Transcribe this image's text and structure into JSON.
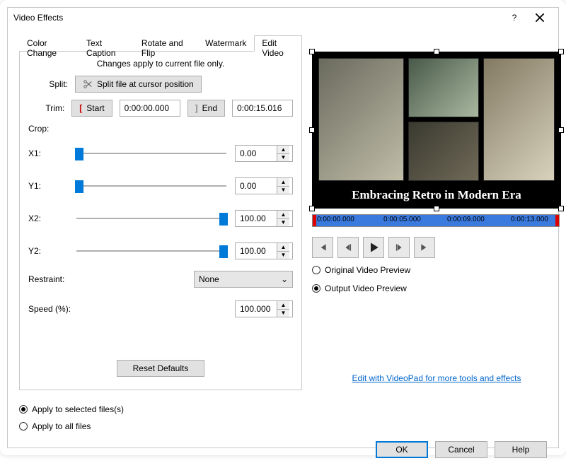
{
  "window": {
    "title": "Video Effects"
  },
  "tabs": [
    "Color Change",
    "Text Caption",
    "Rotate and Flip",
    "Watermark",
    "Edit Video"
  ],
  "panel": {
    "note": "Changes apply to current file only.",
    "split": {
      "label": "Split:",
      "button": "Split file at cursor position"
    },
    "trim": {
      "label": "Trim:",
      "start_label": "Start",
      "start_value": "0:00:00.000",
      "end_label": "End",
      "end_value": "0:00:15.016"
    },
    "crop": {
      "label": "Crop:",
      "x1": {
        "label": "X1:",
        "value": "0.00"
      },
      "y1": {
        "label": "Y1:",
        "value": "0.00"
      },
      "x2": {
        "label": "X2:",
        "value": "100.00"
      },
      "y2": {
        "label": "Y2:",
        "value": "100.00"
      }
    },
    "restraint": {
      "label": "Restraint:",
      "value": "None"
    },
    "speed": {
      "label": "Speed (%):",
      "value": "100.000"
    },
    "reset_label": "Reset Defaults"
  },
  "preview": {
    "overlay_text": "Embracing Retro in Modern Era",
    "timeline": [
      "0:00:00.000",
      "0:00:05.000",
      "0:00:09.000",
      "0:00:13.000"
    ],
    "radio_original": "Original Video Preview",
    "radio_output": "Output Video Preview",
    "edit_link": "Edit with VideoPad for more tools and effects"
  },
  "footer": {
    "apply_selected": "Apply to selected files(s)",
    "apply_all": "Apply to all files",
    "ok": "OK",
    "cancel": "Cancel",
    "help": "Help"
  }
}
